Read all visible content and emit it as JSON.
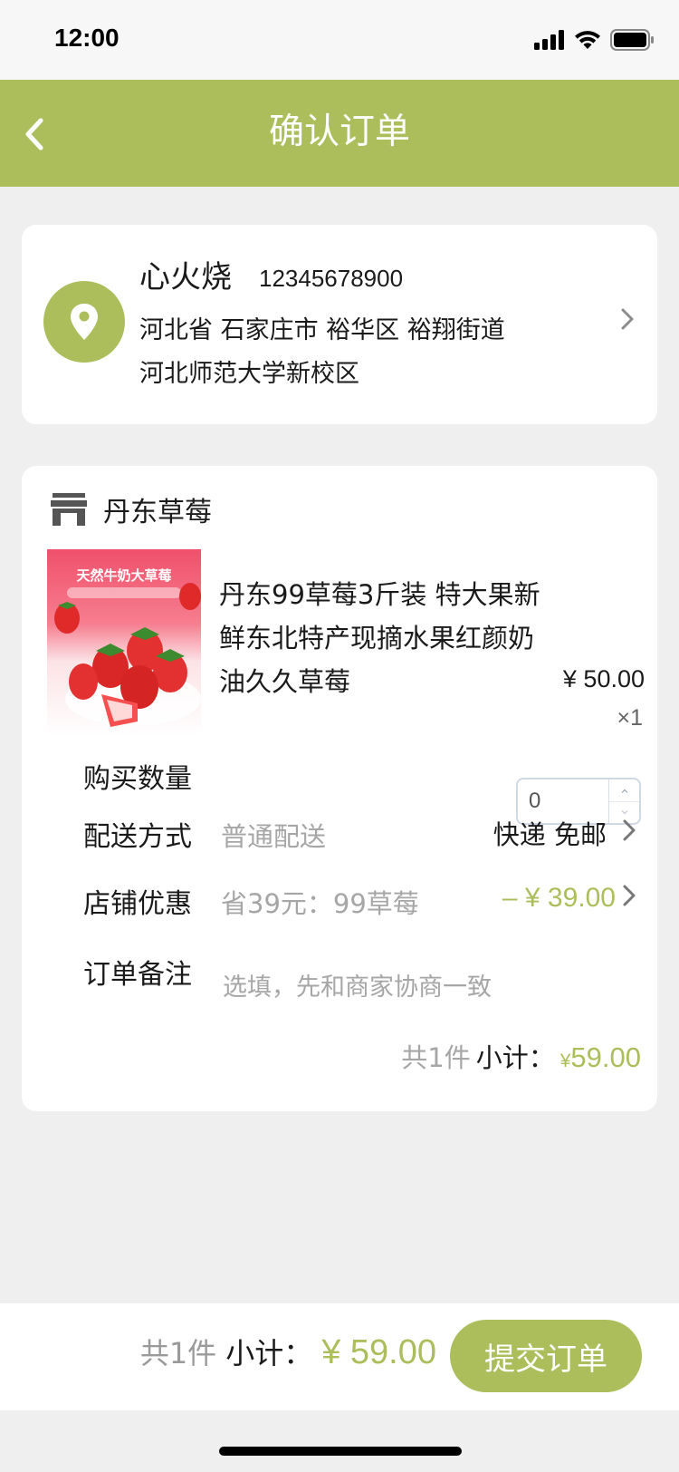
{
  "status_bar": {
    "time": "12:00"
  },
  "nav": {
    "title": "确认订单",
    "back_icon": "chevron-left-icon"
  },
  "address": {
    "name": "心火烧",
    "phone": "12345678900",
    "line1": "河北省 石家庄市 裕华区 裕翔街道",
    "line2": "河北师范大学新校区"
  },
  "shop": {
    "name": "丹东草莓"
  },
  "product": {
    "image_banner": "天然牛奶大草莓",
    "title": "丹东99草莓3斤装 特大果新鲜东北特产现摘水果红颜奶油久久草莓",
    "price": "¥ 50.00",
    "quantity": "×1"
  },
  "form": {
    "quantity_label": "购买数量",
    "quantity_value": "0",
    "shipping_label": "配送方式",
    "shipping_option": "普通配送",
    "shipping_value": "快递 免邮",
    "discount_label": "店铺优惠",
    "discount_desc": "省39元：99草莓",
    "discount_value": "– ¥  39.00",
    "note_label": "订单备注",
    "note_placeholder": "选填，先和商家协商一致"
  },
  "subtotal": {
    "count": "共1件",
    "label": "小计：",
    "currency": "¥",
    "amount": "59.00"
  },
  "bottom": {
    "count": "共1件",
    "label": "小计：",
    "total": "¥ 59.00",
    "submit_label": "提交订单"
  },
  "colors": {
    "accent": "#abbe5b",
    "background": "#efefef"
  }
}
